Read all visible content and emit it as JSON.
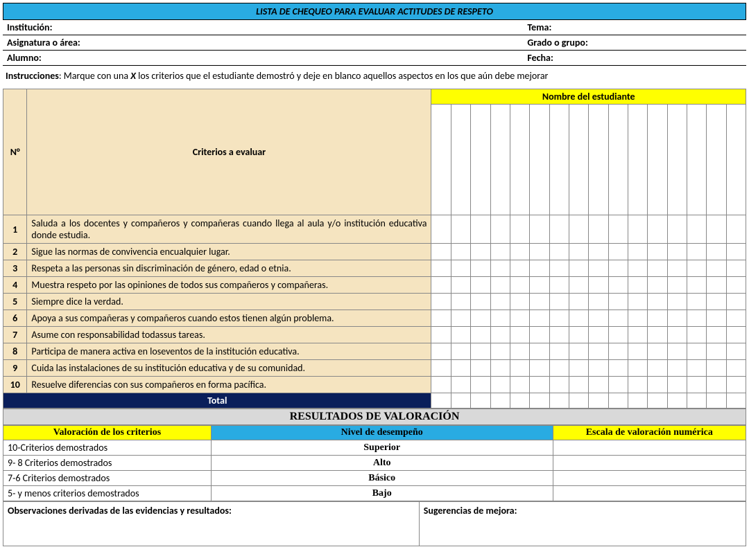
{
  "title": "LISTA DE CHEQUEO PARA EVALUAR ACTITUDES DE RESPETO",
  "meta": {
    "institucion_lbl": "Institución:",
    "tema_lbl": "Tema:",
    "asignatura_lbl": "Asignatura o área:",
    "grado_lbl": "Grado o grupo:",
    "alumno_lbl": "Alumno:",
    "fecha_lbl": "Fecha:"
  },
  "instructions": {
    "lbl": "Instrucciones",
    "text": ": Marque con una ",
    "x": "X",
    "text2": " los criterios que el estudiante demostró y deje en blanco aquellos aspectos en los que aún debe mejorar"
  },
  "headers": {
    "numero": "N°",
    "criterios": "Criterios a evaluar",
    "nombre_estudiante": "Nombre del estudiante"
  },
  "criteria": [
    {
      "n": "1",
      "text": "Saluda a los docentes y compañeros y compañeras cuando llega al aula y/o institución educativa donde estudia."
    },
    {
      "n": "2",
      "text": "Sigue las normas de convivencia encualquier lugar."
    },
    {
      "n": "3",
      "text": "Respeta a las personas sin discriminación de género, edad o etnia."
    },
    {
      "n": "4",
      "text": "Muestra respeto por  las  opiniones de todos sus compañeros y compañeras."
    },
    {
      "n": "5",
      "text": "Siempre dice la verdad."
    },
    {
      "n": "6",
      "text": "Apoya a sus compañeras y compañeros cuando estos tienen algún problema."
    },
    {
      "n": "7",
      "text": "Asume con responsabilidad todassus tareas."
    },
    {
      "n": "8",
      "text": "Participa de manera activa en loseventos de la institución educativa."
    },
    {
      "n": "9",
      "text": "Cuida las instalaciones de su institución educativa y de su comunidad."
    },
    {
      "n": "10",
      "text": "Resuelve diferencias con sus compañeros en forma pacífica."
    }
  ],
  "total_lbl": "Total",
  "student_cols": 16,
  "results": {
    "title": "RESULTADOS DE VALORACIÓN",
    "hdr_valoracion": "Valoración de los criterios",
    "hdr_nivel": "Nivel de desempeño",
    "hdr_escala": "Escala de valoración numérica",
    "rows": [
      {
        "val": "10-Criterios demostrados",
        "nivel": "Superior"
      },
      {
        "val": "9- 8 Criterios demostrados",
        "nivel": "Alto"
      },
      {
        "val": "7-6 Criterios demostrados",
        "nivel": "Básico"
      },
      {
        "val": "5- y menos criterios demostrados",
        "nivel": "Bajo"
      }
    ],
    "observaciones_lbl": "Observaciones derivadas de las evidencias y resultados:",
    "sugerencias_lbl": "Sugerencias de mejora:"
  }
}
